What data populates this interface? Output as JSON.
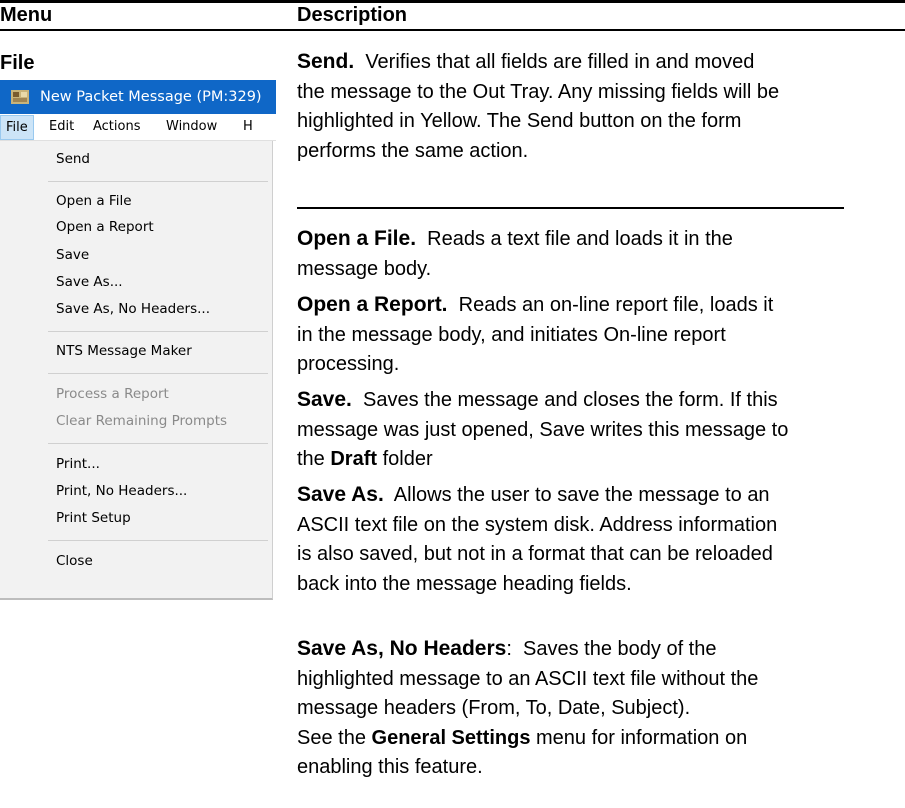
{
  "table": {
    "col_menu": "Menu",
    "col_description": "Description",
    "row_label": "File"
  },
  "screenshot": {
    "title": "New Packet Message  (PM:329)",
    "app_icon": "packet-radio-app-icon",
    "menubar": [
      "File",
      "Edit",
      "Actions",
      "Window",
      "H"
    ],
    "menu_items": [
      {
        "label": "Send",
        "enabled": true
      },
      {
        "label": "Open a File",
        "enabled": true
      },
      {
        "label": "Open a Report",
        "enabled": true
      },
      {
        "label": "Save",
        "enabled": true
      },
      {
        "label": "Save As...",
        "enabled": true
      },
      {
        "label": "Save As, No Headers...",
        "enabled": true
      },
      {
        "label": "NTS Message Maker",
        "enabled": true
      },
      {
        "label": "Process a Report",
        "enabled": false
      },
      {
        "label": "Clear Remaining Prompts",
        "enabled": false
      },
      {
        "label": "Print...",
        "enabled": true
      },
      {
        "label": "Print, No Headers...",
        "enabled": true
      },
      {
        "label": "Print Setup",
        "enabled": true
      },
      {
        "label": "Close",
        "enabled": true
      }
    ],
    "colors": {
      "titlebar": "#0f67c7",
      "menu_bg": "#f2f2f2",
      "disabled_text": "#8a8a8a"
    }
  },
  "descriptions": {
    "send": {
      "term": "Send.",
      "lines": [
        "Verifies that all fields are filled in and moved",
        "the message to the Out Tray.  Any missing fields will be",
        "highlighted in Yellow.  The Send button on the form",
        "performs the same action."
      ]
    },
    "open_file": {
      "term": "Open a File.",
      "lines": [
        "Reads a text file and loads it in the",
        "message body."
      ]
    },
    "open_report": {
      "term": "Open a Report.",
      "lines": [
        "Reads an on-line report file, loads it",
        "in the message body, and initiates On-line report",
        "processing."
      ]
    },
    "save": {
      "term": "Save.",
      "lines": [
        "Saves the message and closes the form.  If this",
        "message was just opened, Save writes this message to",
        "the "
      ],
      "bold_word": "Draft",
      "tail": " folder"
    },
    "save_as": {
      "term": "Save As.",
      "lines": [
        "Allows the user to save the message to an",
        "ASCII text file on the system disk.  Address information",
        "is also saved, but not in a format that can be reloaded",
        "back into the message heading fields."
      ]
    },
    "save_as_no_headers": {
      "term": "Save As, No Headers",
      "term_suffix": ":",
      "lines": [
        "Saves the body of the",
        "highlighted message to an ASCII text file without the",
        "message headers (From, To, Date, Subject)."
      ],
      "see_prefix": "See the ",
      "see_bold": "General Settings",
      "see_suffix": " menu for information on",
      "last_line": "enabling this feature."
    }
  }
}
